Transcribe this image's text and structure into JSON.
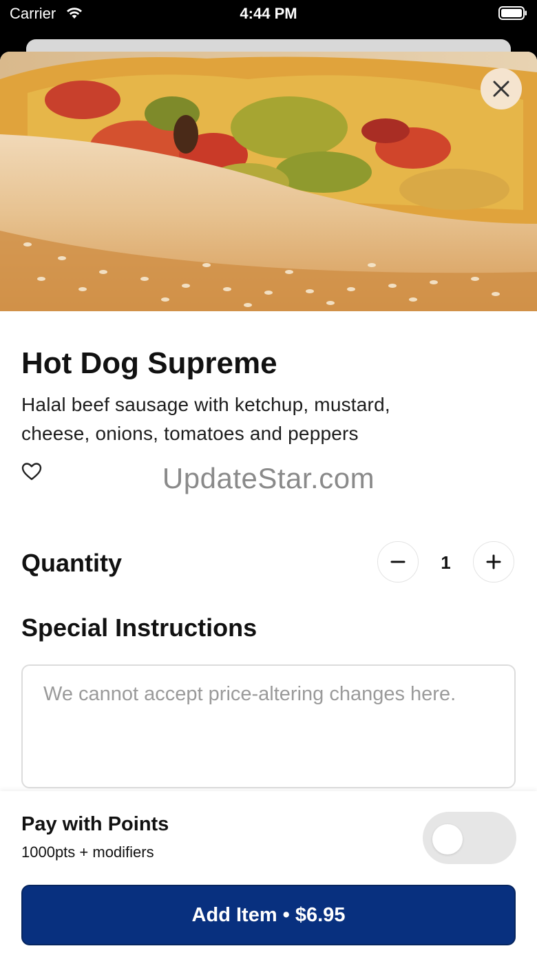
{
  "status_bar": {
    "carrier": "Carrier",
    "time": "4:44 PM"
  },
  "item": {
    "title": "Hot Dog Supreme",
    "description": "Halal beef sausage with ketchup, mustard, cheese, onions, tomatoes and peppers"
  },
  "watermark": "UpdateStar.com",
  "quantity": {
    "label": "Quantity",
    "value": "1"
  },
  "instructions": {
    "label": "Special Instructions",
    "placeholder": "We cannot accept price-altering changes here."
  },
  "points": {
    "title": "Pay with Points",
    "subtitle": "1000pts + modifiers",
    "enabled": false
  },
  "add_button": {
    "label": "Add Item • $6.95"
  },
  "colors": {
    "primary": "#08307f",
    "toggle_off": "#e6e6e6"
  },
  "icons": {
    "close": "close-icon",
    "favorite": "heart-outline-icon",
    "minus": "minus-icon",
    "plus": "plus-icon",
    "wifi": "wifi-icon",
    "battery": "battery-icon"
  }
}
